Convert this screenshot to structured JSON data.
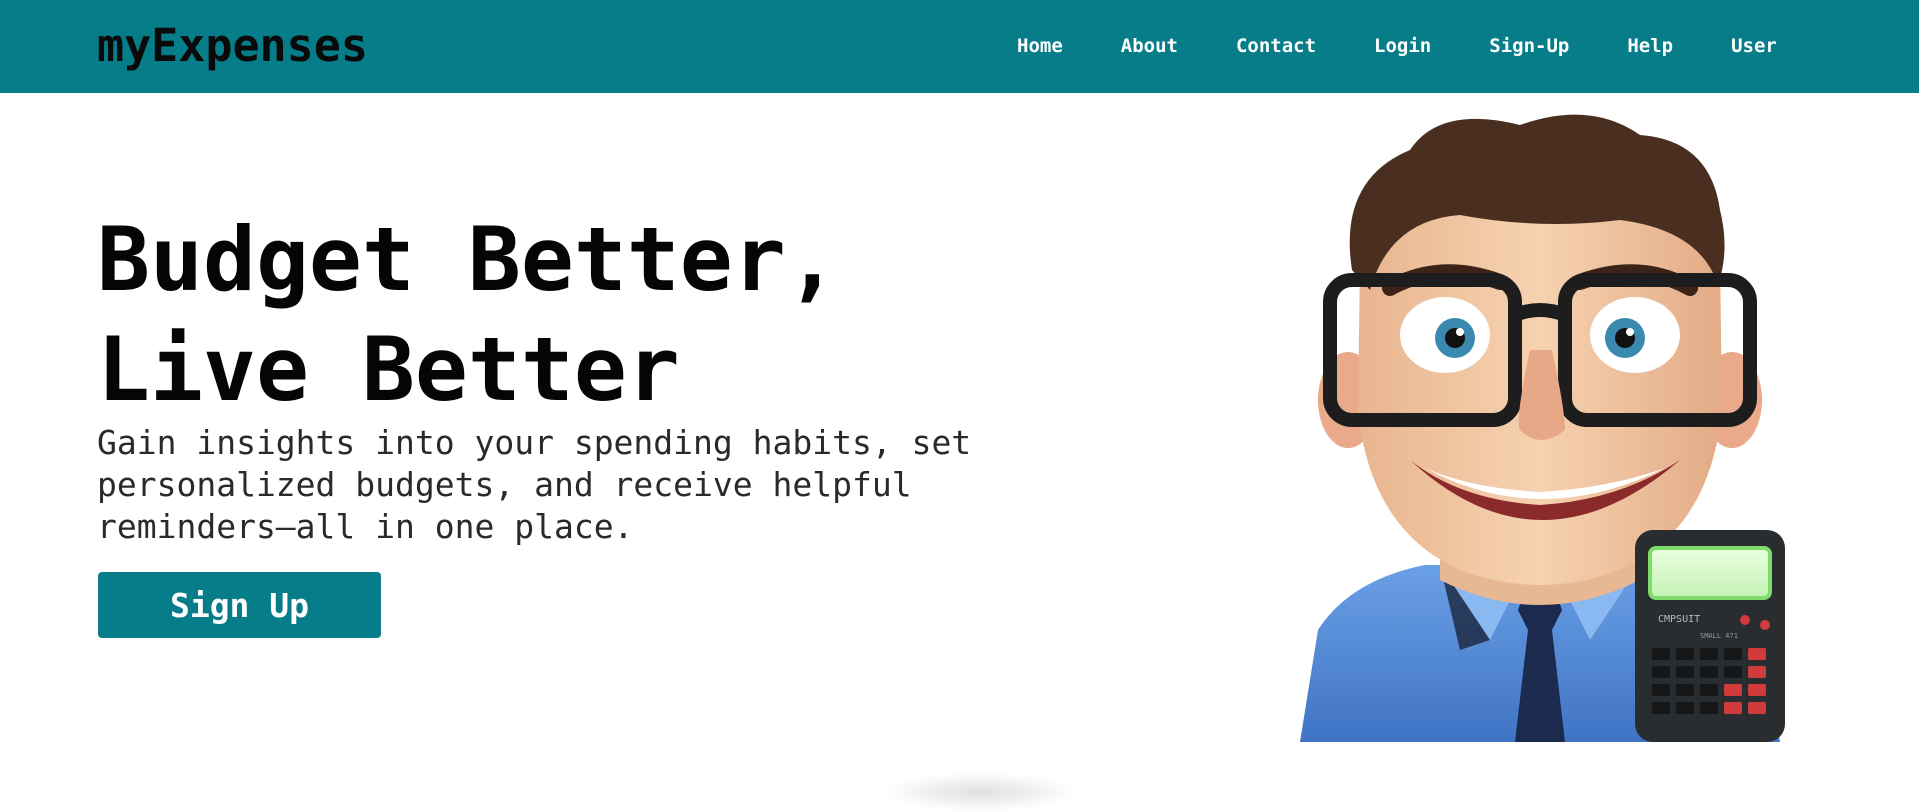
{
  "header": {
    "brand": "myExpenses",
    "nav": [
      {
        "label": "Home"
      },
      {
        "label": "About"
      },
      {
        "label": "Contact"
      },
      {
        "label": "Login"
      },
      {
        "label": "Sign-Up"
      },
      {
        "label": "Help"
      },
      {
        "label": "User"
      }
    ]
  },
  "hero": {
    "title_line1": "Budget Better,",
    "title_line2": "Live Better",
    "subtitle": "Gain insights into your spending habits, set personalized budgets, and receive helpful reminders—all in one place.",
    "cta_label": "Sign Up"
  },
  "illustration": {
    "calculator_brand": "CMPSUIT",
    "calculator_model": "SMALL 471"
  },
  "colors": {
    "brand_teal": "#067d88",
    "text_dark": "#050505",
    "shirt_blue": "#5b8fd8",
    "skin": "#f1c6a0",
    "hair": "#4a2f20"
  }
}
